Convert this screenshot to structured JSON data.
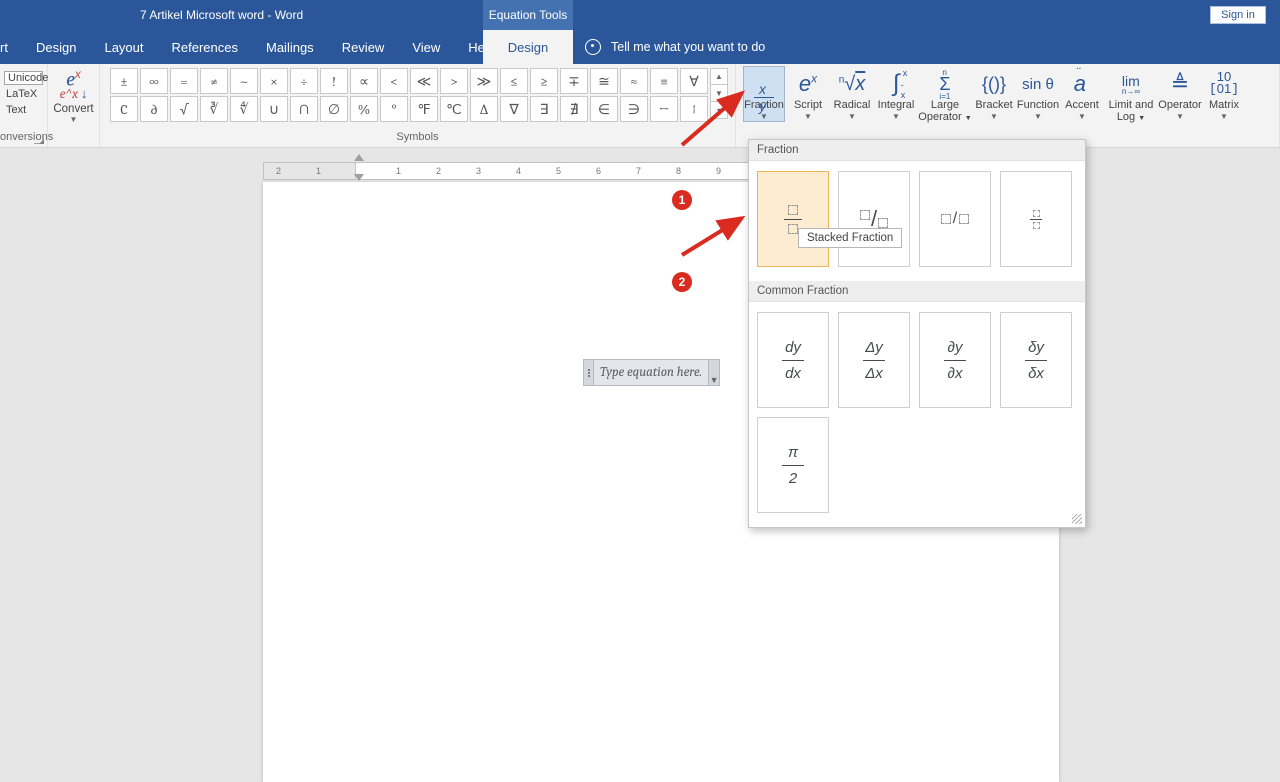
{
  "title": "7 Artikel Microsoft word  -  Word",
  "context_tab": "Equation Tools",
  "signin": "Sign in",
  "tabs": [
    "sert",
    "Design",
    "Layout",
    "References",
    "Mailings",
    "Review",
    "View",
    "Help"
  ],
  "design_tab": "Design",
  "tellme": "Tell me what you want to do",
  "g1_items": {
    "unicode": "Unicode",
    "latex": "LaTeX",
    "text": "Text"
  },
  "g1_label": "onversions",
  "convert_label": "Convert",
  "symbols_label": "Symbols",
  "sym_row1": [
    "±",
    "∞",
    "=",
    "≠",
    "~",
    "×",
    "÷",
    "!",
    "∝",
    "<",
    "≪",
    ">",
    "≫",
    "≤",
    "≥",
    "∓",
    "≅",
    "≈",
    "≡",
    "∀"
  ],
  "sym_row2": [
    "C",
    "∂",
    "√",
    "∛",
    "∜",
    "∪",
    "∩",
    "∅",
    "%",
    "°",
    "℉",
    "℃",
    "∆",
    "∇",
    "∃",
    "∄",
    "∈",
    "∋",
    "←",
    "↑"
  ],
  "structs": [
    {
      "label": "Fraction",
      "active": true
    },
    {
      "label": "Script"
    },
    {
      "label": "Radical"
    },
    {
      "label": "Integral"
    },
    {
      "label": "Large Operator",
      "two": "Large|Operator"
    },
    {
      "label": "Bracket"
    },
    {
      "label": "Function"
    },
    {
      "label": "Accent"
    },
    {
      "label": "Limit and Log",
      "two": "Limit and|Log"
    },
    {
      "label": "Operator"
    },
    {
      "label": "Matrix"
    }
  ],
  "struct_icons": [
    "x/y",
    "eˣ",
    "ⁿ√x",
    "∫",
    "Σ",
    "{()}",
    "sin θ",
    "ä",
    "lim",
    "∆",
    "[10;01]"
  ],
  "eq_placeholder": "Type equation here.",
  "panel": {
    "h1": "Fraction",
    "h2": "Common Fraction",
    "tooltip": "Stacked Fraction",
    "common": [
      "dy|dx",
      "Δy|Δx",
      "∂y|∂x",
      "δy|δx",
      "π|2"
    ]
  },
  "badges": [
    "1",
    "2"
  ]
}
